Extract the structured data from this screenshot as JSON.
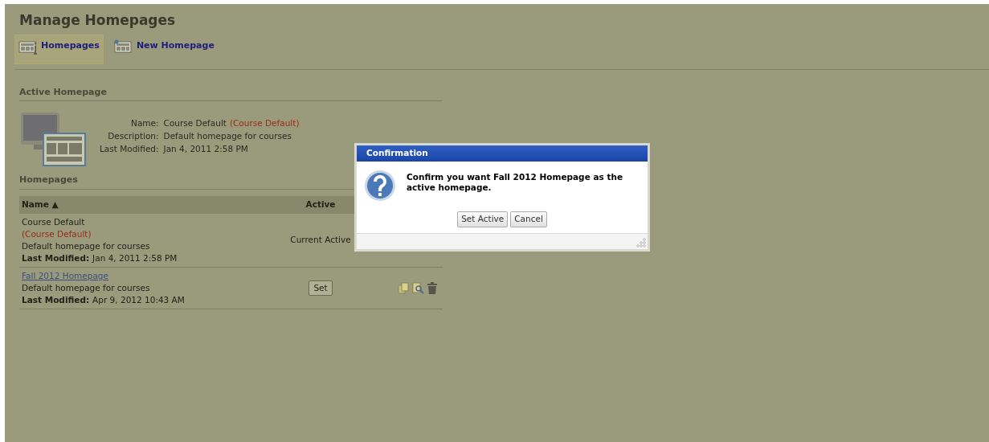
{
  "page_title": "Manage Homepages",
  "tabs": [
    {
      "label": "Homepages",
      "selected": true
    },
    {
      "label": "New Homepage",
      "selected": false
    }
  ],
  "active_homepage": {
    "heading": "Active Homepage",
    "fields": [
      {
        "label": "Name:",
        "value": "Course Default",
        "note": "(Course Default)"
      },
      {
        "label": "Description:",
        "value": "Default homepage for courses"
      },
      {
        "label": "Last Modified:",
        "value": "Jan 4, 2011 2:58 PM"
      }
    ]
  },
  "homepages": {
    "heading": "Homepages",
    "columns": [
      "Name ▲",
      "Active"
    ],
    "rows": [
      {
        "name": "Course Default",
        "is_link": false,
        "note": "(Course Default)",
        "description": "Default homepage for courses",
        "modified_label": "Last Modified:",
        "modified": "Jan 4, 2011 2:58 PM",
        "kind": "text",
        "active_text": "Current Active"
      },
      {
        "name": "Fall 2012 Homepage",
        "is_link": true,
        "description": "Default homepage for courses",
        "modified_label": "Last Modified:",
        "modified": "Apr 9, 2012 10:43 AM",
        "kind": "button",
        "active_text": "Set",
        "actions": true
      }
    ]
  },
  "dialog": {
    "title": "Confirmation",
    "message": "Confirm you want Fall 2012 Homepage as the active homepage.",
    "buttons": [
      "Set Active",
      "Cancel"
    ]
  }
}
